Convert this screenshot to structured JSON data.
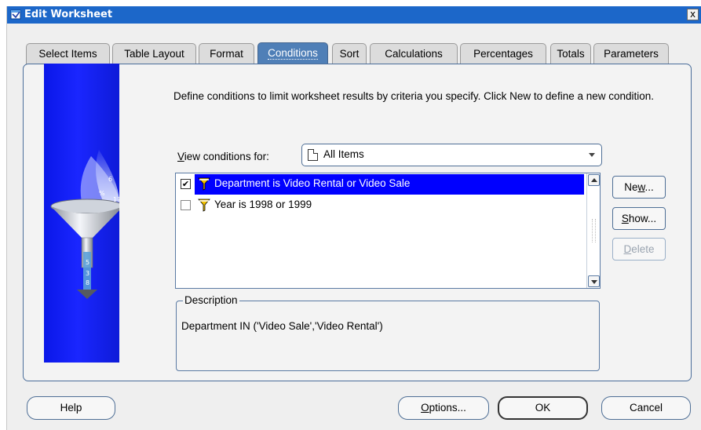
{
  "window": {
    "title": "Edit Worksheet",
    "close_glyph": "x"
  },
  "tabs": [
    {
      "label": "Select Items"
    },
    {
      "label": "Table Layout"
    },
    {
      "label": "Format"
    },
    {
      "label": "Conditions",
      "active": true
    },
    {
      "label": "Sort"
    },
    {
      "label": "Calculations"
    },
    {
      "label": "Percentages"
    },
    {
      "label": "Totals"
    },
    {
      "label": "Parameters"
    }
  ],
  "conditions": {
    "instructions": "Define conditions to limit worksheet results by criteria you specify. Click New to define a new condition.",
    "view_label_mnemonic": "V",
    "view_label_rest": "iew conditions for:",
    "view_selected": "All Items",
    "items": [
      {
        "text": "Department is Video Rental or Video Sale",
        "checked": true,
        "selected": true,
        "check_glyph": "✔"
      },
      {
        "text": "Year is 1998 or 1999",
        "checked": false,
        "selected": false,
        "check_glyph": ""
      }
    ],
    "buttons": {
      "new_pre": "Ne",
      "new_mnemonic": "w",
      "new_post": "...",
      "show_mnemonic": "S",
      "show_post": "how...",
      "delete_mnemonic": "D",
      "delete_post": "elete"
    },
    "description_legend": "Description",
    "description_value": "Department IN ('Video Sale','Video Rental')"
  },
  "footer": {
    "help": "Help",
    "options_mnemonic": "O",
    "options_post": "ptions...",
    "ok": "OK",
    "cancel": "Cancel"
  },
  "icons": {
    "title": "worksheet-icon",
    "combo": "document-icon",
    "row": "funnel-icon",
    "illustration": "funnel-illustration"
  },
  "colors": {
    "titlebar": "#1c67c9",
    "active_tab": "#4f7fb7",
    "selection": "#0000ff",
    "illustration": "#1a26ff",
    "border": "#4f6f96"
  }
}
